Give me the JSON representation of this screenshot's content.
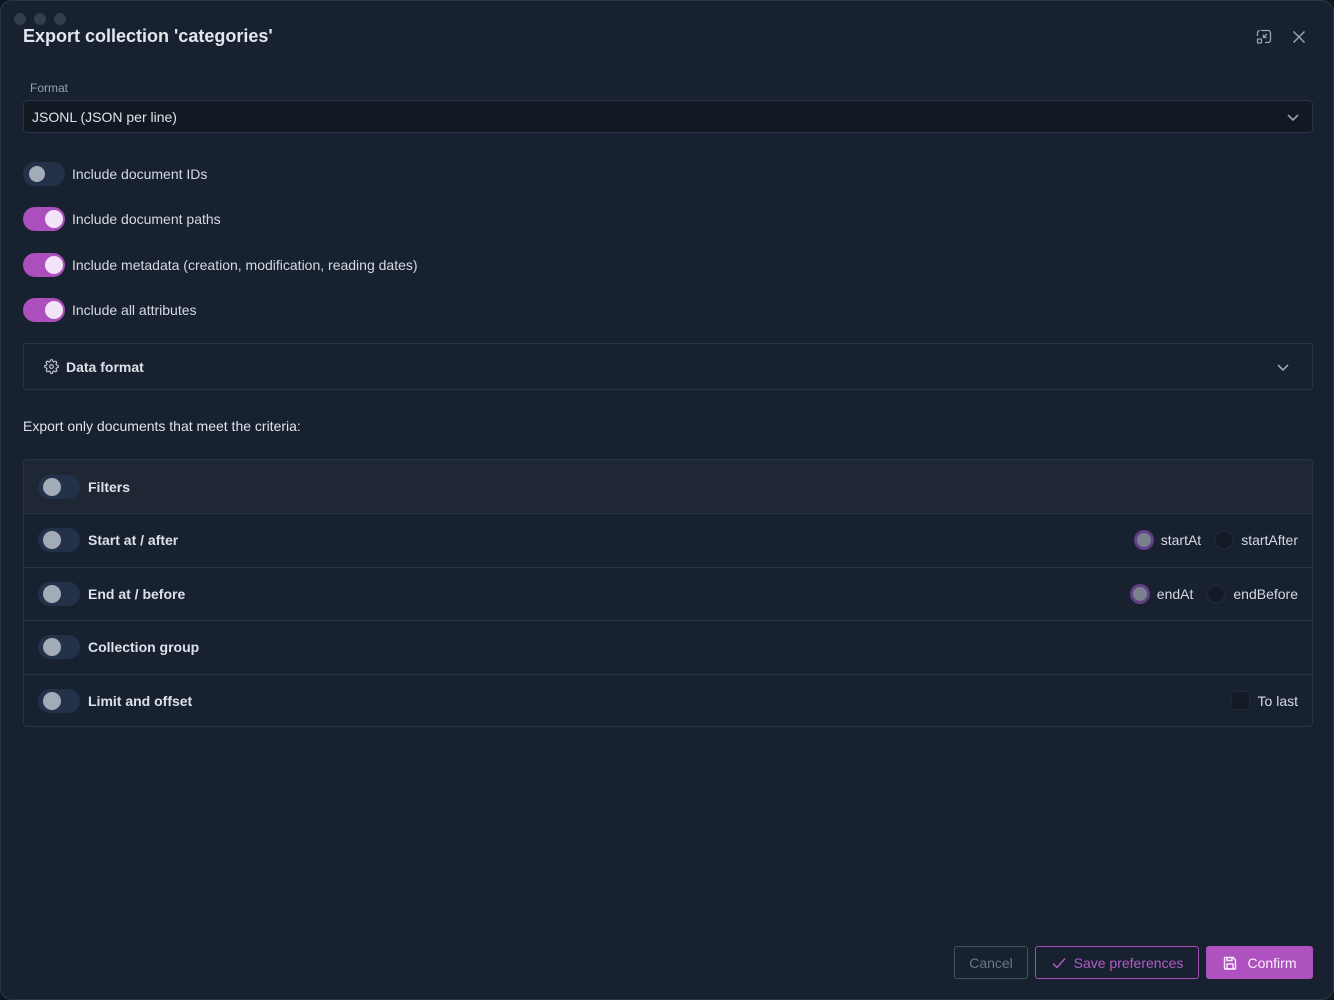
{
  "dialog": {
    "title": "Export collection 'categories'",
    "icons": {
      "minimize": "minimize-window-icon",
      "close": "close-icon"
    }
  },
  "format": {
    "label": "Format",
    "selected": "JSONL (JSON per line)"
  },
  "options": [
    {
      "label": "Include document IDs",
      "on": false
    },
    {
      "label": "Include document paths",
      "on": true
    },
    {
      "label": "Include metadata (creation, modification, reading dates)",
      "on": true
    },
    {
      "label": "Include all attributes",
      "on": true
    }
  ],
  "data_format": {
    "title": "Data format",
    "icon": "gear-icon",
    "expanded": false
  },
  "criteria": {
    "heading": "Export only documents that meet the criteria:",
    "rows": [
      {
        "label": "Filters",
        "on": false
      },
      {
        "label": "Start at / after",
        "on": false,
        "radios": [
          {
            "label": "startAt",
            "checked": true
          },
          {
            "label": "startAfter",
            "checked": false
          }
        ]
      },
      {
        "label": "End at / before",
        "on": false,
        "radios": [
          {
            "label": "endAt",
            "checked": true
          },
          {
            "label": "endBefore",
            "checked": false
          }
        ]
      },
      {
        "label": "Collection group",
        "on": false
      },
      {
        "label": "Limit and offset",
        "on": false,
        "checkbox": {
          "label": "To last",
          "checked": false
        }
      }
    ]
  },
  "footer": {
    "cancel": "Cancel",
    "save_preferences": "Save preferences",
    "confirm": "Confirm"
  },
  "colors": {
    "accent": "#ab4fbd",
    "background": "#172130",
    "border": "#273449"
  }
}
